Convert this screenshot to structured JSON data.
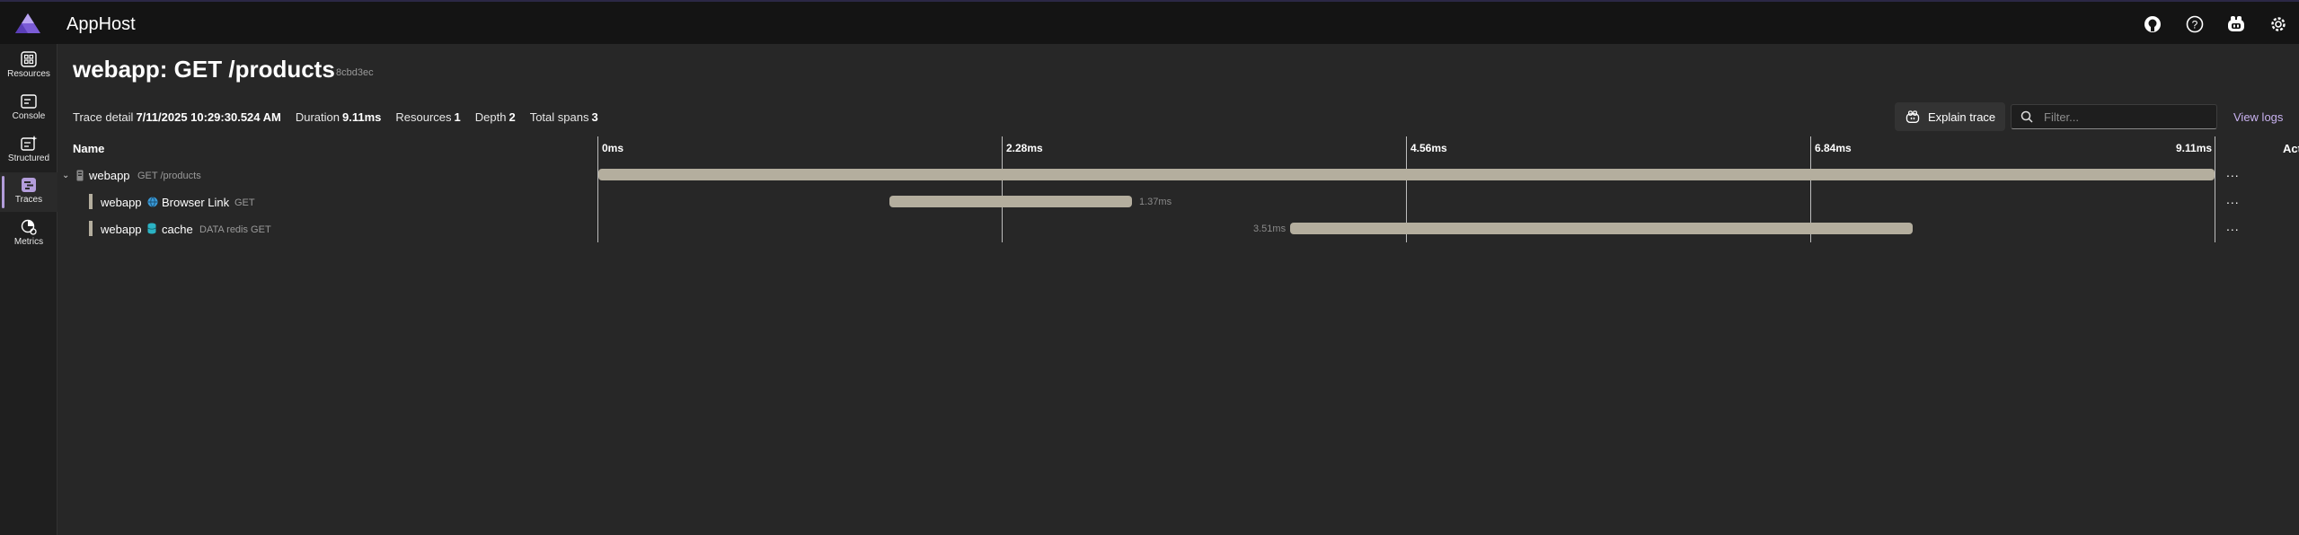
{
  "header": {
    "app_title": "AppHost",
    "icons": [
      "github-icon",
      "help-icon",
      "copilot-icon",
      "settings-icon"
    ]
  },
  "sidebar": {
    "items": [
      {
        "label": "Resources",
        "icon": "resources-icon"
      },
      {
        "label": "Console",
        "icon": "console-icon"
      },
      {
        "label": "Structured",
        "icon": "structured-icon"
      },
      {
        "label": "Traces",
        "icon": "traces-icon",
        "active": true
      },
      {
        "label": "Metrics",
        "icon": "metrics-icon"
      }
    ]
  },
  "page": {
    "title": "webapp: GET /products",
    "trace_id": "8cbd3ec"
  },
  "summary": {
    "trace_detail_label": "Trace detail",
    "trace_detail_value": "7/11/2025 10:29:30.524 AM",
    "duration_label": "Duration",
    "duration_value": "9.11ms",
    "resources_label": "Resources",
    "resources_value": "1",
    "depth_label": "Depth",
    "depth_value": "2",
    "total_spans_label": "Total spans",
    "total_spans_value": "3"
  },
  "toolbar": {
    "explain_trace_label": "Explain trace",
    "filter_placeholder": "Filter...",
    "view_logs_label": "View logs"
  },
  "grid": {
    "name_header": "Name",
    "actions_header": "Actions",
    "ticks": [
      "0ms",
      "2.28ms",
      "4.56ms",
      "6.84ms",
      "9.11ms"
    ],
    "actions_glyph": "...",
    "rows": [
      {
        "service": "webapp",
        "operation": "GET /products",
        "start_ms": 0,
        "duration_ms": 9.11,
        "duration_label": "",
        "icon": "server-icon",
        "depth": 0
      },
      {
        "service": "webapp",
        "target": "Browser Link",
        "operation": "GET",
        "start_ms": 1.64,
        "duration_ms": 1.37,
        "duration_label": "1.37ms",
        "icon": "globe-icon",
        "depth": 1
      },
      {
        "service": "webapp",
        "target": "cache",
        "operation": "DATA redis GET",
        "start_ms": 3.9,
        "duration_ms": 3.51,
        "duration_label": "3.51ms",
        "icon": "database-icon",
        "depth": 1
      }
    ]
  },
  "colors": {
    "accent": "#b39ddb",
    "bar": "#b4ae9e",
    "background": "#272727",
    "topbar": "#141414"
  }
}
